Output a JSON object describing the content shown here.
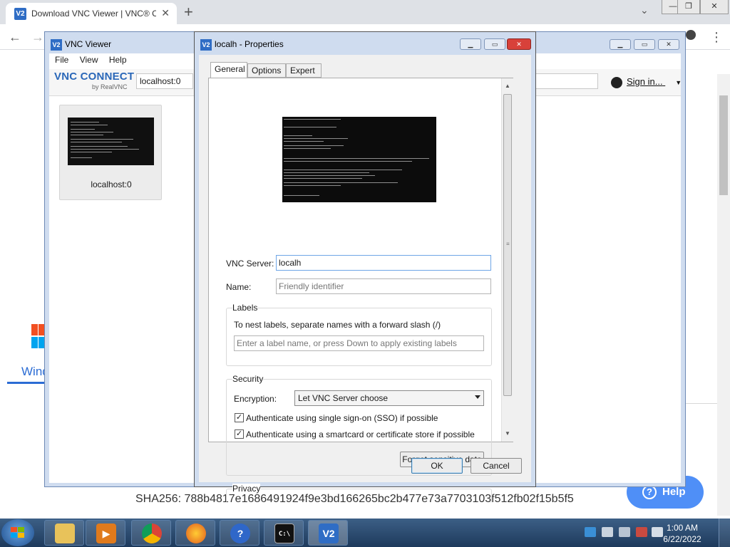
{
  "browser": {
    "tab_title": "Download VNC Viewer | VNC® C",
    "tab_favicon": "V2",
    "tab_close": "✕",
    "new_tab": "+",
    "back": "←",
    "forward": "→",
    "menu_dots": "⋮"
  },
  "page": {
    "sha": "SHA256: 788b4817e1686491924f9e3bd166265bc2b477e73a7703103f512fb02f15b5f5",
    "help_button": "Help",
    "help_icon": "?",
    "windows_label": "Wind",
    "side_glyph": "I",
    "accent_color": "#2b6cd4"
  },
  "vnc_main": {
    "title": "VNC Viewer",
    "icon": "V2",
    "menu": [
      "File",
      "View",
      "Help"
    ],
    "brand": "VNC CONNECT",
    "brand_sub": "by RealVNC",
    "search_value": "localhost:0",
    "sign_in": "Sign in...",
    "sign_in_arrow": "▼",
    "connection_label": "localhost:0"
  },
  "dialog": {
    "title": "localh - Properties",
    "icon": "V2",
    "tabs": [
      "General",
      "Options",
      "Expert"
    ],
    "vnc_server_label": "VNC Server:",
    "vnc_server_value": "localh",
    "name_label": "Name:",
    "name_placeholder": "Friendly identifier",
    "labels_group": "Labels",
    "labels_hint": "To nest labels, separate names with a forward slash (/)",
    "labels_placeholder": "Enter a label name, or press Down to apply existing labels",
    "security_group": "Security",
    "encryption_label": "Encryption:",
    "encryption_value": "Let VNC Server choose",
    "sso_label": "Authenticate using single sign-on (SSO) if possible",
    "sso_checked": "✓",
    "smartcard_label": "Authenticate using a smartcard or certificate store if possible",
    "smartcard_checked": "✓",
    "forget_button": "Forget sensitive data",
    "privacy_group": "Privacy",
    "ok_button": "OK",
    "cancel_button": "Cancel",
    "close_glyph": "✕"
  },
  "taskbar": {
    "time": "1:00 AM",
    "date": "6/22/2022",
    "vnc_icon": "V2",
    "help_icon": "?",
    "cmd_icon": "C:\\"
  }
}
